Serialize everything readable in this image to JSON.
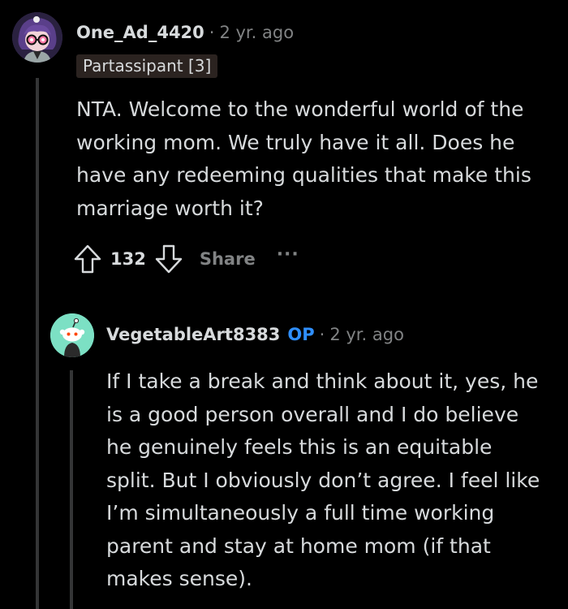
{
  "comment1": {
    "username": "One_Ad_4420",
    "separator": "·",
    "time": "2 yr. ago",
    "flair": "Partassipant [3]",
    "body": "NTA. Welcome to the wonderful world of the working mom. We truly have it all. Does he have any redeeming qualities that make this marriage worth it?",
    "score": "132",
    "share_label": "Share",
    "more_label": "···",
    "avatar_icon": "anime-character-avatar-icon"
  },
  "comment2": {
    "username": "VegetableArt8383",
    "op_badge": "OP",
    "separator": "·",
    "time": "2 yr. ago",
    "body": "If I take a break and think about it, yes, he is a good person overall and I do believe he genuinely feels this is an equitable split. But I obviously don’t agree. I feel like I’m simultaneously a full time working parent and stay at home mom (if that makes sense).",
    "avatar_icon": "snoo-default-avatar-icon"
  },
  "colors": {
    "background": "#000000",
    "text": "#d7dadc",
    "muted": "#818384",
    "op": "#2f8fff",
    "flair_bg": "#2b2320",
    "thread_line": "#343536",
    "avatar2_bg": "#7ce0c4"
  }
}
